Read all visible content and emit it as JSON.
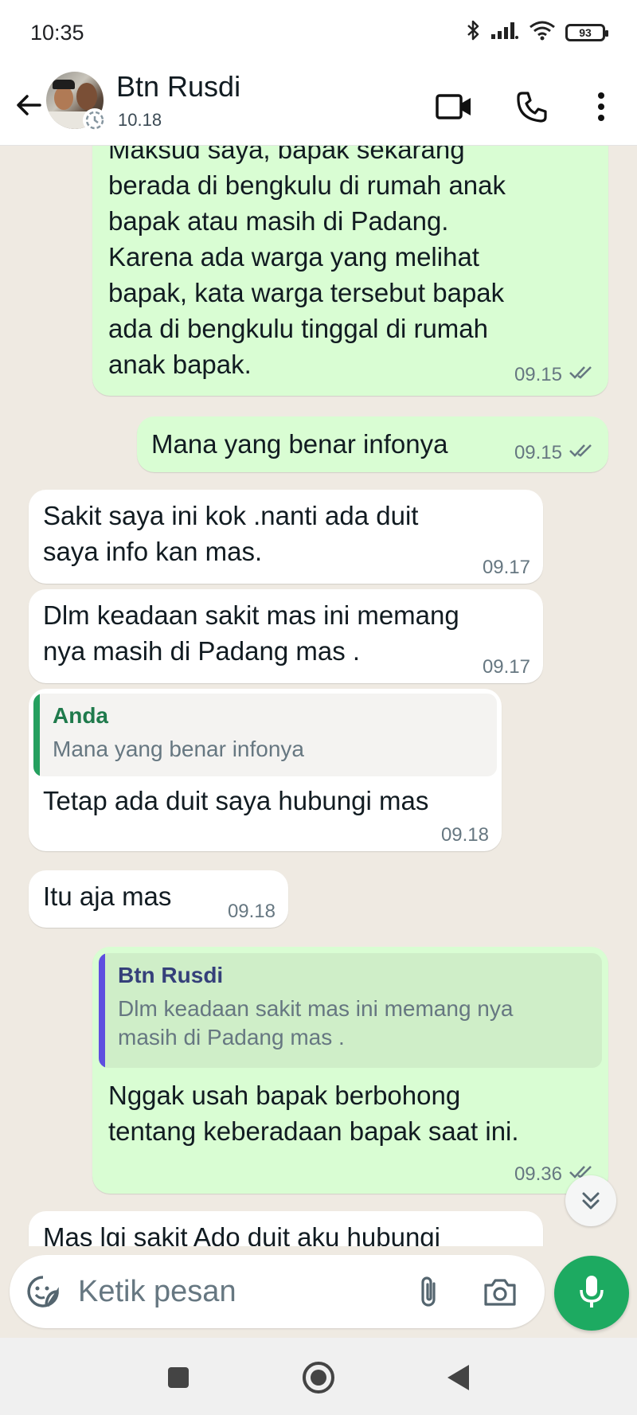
{
  "status_bar": {
    "time": "10:35",
    "battery": "93"
  },
  "header": {
    "contact_name": "Btn Rusdi",
    "subtitle": "10.18"
  },
  "messages": [
    {
      "direction": "out",
      "text": "Maksud saya, bapak sekarang\nberada di bengkulu di rumah anak\nbapak atau masih di Padang.\nKarena ada warga yang melihat\nbapak, kata warga tersebut bapak\nada di bengkulu tinggal di rumah\nanak bapak.",
      "time": "09.15",
      "read": true
    },
    {
      "direction": "out",
      "text": "Mana yang benar infonya",
      "time": "09.15",
      "read": true
    },
    {
      "direction": "in",
      "text": "Sakit saya ini kok .nanti ada duit\nsaya info kan mas.",
      "time": "09.17"
    },
    {
      "direction": "in",
      "text": "Dlm keadaan sakit mas ini memang\nnya masih di Padang mas .",
      "time": "09.17"
    },
    {
      "direction": "in",
      "quote": {
        "author": "Anda",
        "text": "Mana yang benar infonya"
      },
      "text": "Tetap ada duit saya hubungi mas",
      "time": "09.18"
    },
    {
      "direction": "in",
      "text": "Itu aja mas",
      "time": "09.18"
    },
    {
      "direction": "out",
      "quote": {
        "author": "Btn Rusdi",
        "text": "Dlm keadaan sakit mas ini memang nya\nmasih di Padang mas ."
      },
      "text": "Nggak usah bapak berbohong\ntentang keberadaan bapak saat ini.",
      "time": "09.36",
      "read": true
    },
    {
      "direction": "in",
      "text": "Mas lgi sakit Ado duit aku hubungi"
    }
  ],
  "composer": {
    "placeholder": "Ketik pesan"
  },
  "colors": {
    "outgoing_bubble": "#d9fdd3",
    "incoming_bubble": "#ffffff",
    "chat_background": "#efeae2",
    "accent_green": "#1daa61",
    "read_tick": "#667781",
    "quote_author_anda": "#1f7a4c",
    "quote_author_contact": "#35407a",
    "quote_bar_anda": "#25a05f",
    "quote_bar_contact": "#5e4ee0"
  },
  "icons": [
    "back-arrow-icon",
    "video-call-icon",
    "phone-icon",
    "more-vert-icon",
    "emoji-sticker-icon",
    "attach-icon",
    "camera-icon",
    "mic-icon",
    "scroll-down-icon",
    "nav-recents-icon",
    "nav-home-icon",
    "nav-back-icon",
    "bluetooth-icon",
    "signal-icon",
    "wifi-icon",
    "battery-icon"
  ]
}
